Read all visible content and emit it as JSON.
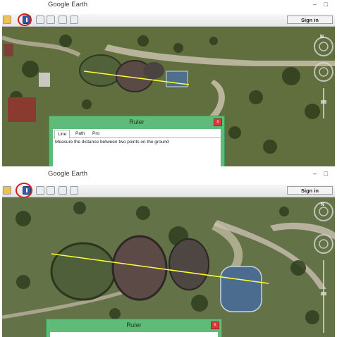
{
  "top_panel": {
    "window_title": "Google Earth",
    "window_controls": {
      "minimize": "–",
      "restore": "□"
    },
    "sign_in_label": "Sign in",
    "ruler_dialog": {
      "title": "Ruler",
      "close_label": "x",
      "tabs": [
        "Line",
        "Path",
        "Pro"
      ],
      "description": "Measure the distance between two points on the ground"
    },
    "compass_label": "N"
  },
  "bottom_panel": {
    "window_title": "Google Earth",
    "window_controls": {
      "minimize": "–",
      "restore": "□"
    },
    "sign_in_label": "Sign in",
    "ruler_dialog": {
      "title": "Ruler",
      "close_label": "x"
    },
    "compass_label": "N"
  },
  "colors": {
    "measure_line": "#ffff33",
    "highlight_circle": "#d21f1f",
    "dialog_green": "#5fbc78"
  }
}
